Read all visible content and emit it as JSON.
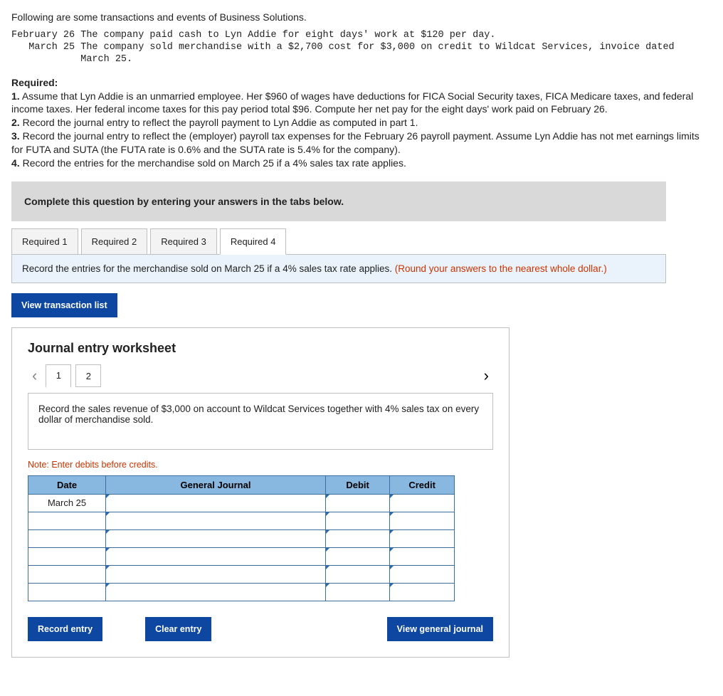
{
  "intro": "Following are some transactions and events of Business Solutions.",
  "mono_block": "February 26 The company paid cash to Lyn Addie for eight days' work at $120 per day.\n   March 25 The company sold merchandise with a $2,700 cost for $3,000 on credit to Wildcat Services, invoice dated\n            March 25.",
  "required": {
    "heading": "Required:",
    "r1": "1. Assume that Lyn Addie is an unmarried employee. Her $960 of wages have deductions for FICA Social Security taxes, FICA Medicare taxes, and federal income taxes. Her federal income taxes for this pay period total $96. Compute her net pay for the eight days' work paid on February 26.",
    "r2": "2. Record the journal entry to reflect the payroll payment to Lyn Addie as computed in part 1.",
    "r3": "3. Record the journal entry to reflect the (employer) payroll tax expenses for the February 26 payroll payment. Assume Lyn Addie has not met earnings limits for FUTA and SUTA (the FUTA rate is 0.6% and the SUTA rate is 5.4% for the company).",
    "r4": "4. Record the entries for the merchandise sold on March 25 if a 4% sales tax rate applies."
  },
  "instruction_bar": "Complete this question by entering your answers in the tabs below.",
  "tabs": [
    "Required 1",
    "Required 2",
    "Required 3",
    "Required 4"
  ],
  "active_tab": 3,
  "tab_prompt": {
    "text": "Record the entries for the merchandise sold on March 25 if a 4% sales tax rate applies. ",
    "hint": "(Round your answers to the nearest whole dollar.)"
  },
  "view_trans_btn": "View transaction list",
  "worksheet": {
    "title": "Journal entry worksheet",
    "pages": [
      "1",
      "2"
    ],
    "active_page": 0,
    "desc": "Record the sales revenue of $3,000 on account to Wildcat Services together with 4% sales tax on every dollar of merchandise sold.",
    "note": "Note: Enter debits before credits.",
    "headers": {
      "date": "Date",
      "gj": "General Journal",
      "debit": "Debit",
      "credit": "Credit"
    },
    "rows": [
      {
        "date": "March 25",
        "gj": "",
        "debit": "",
        "credit": ""
      },
      {
        "date": "",
        "gj": "",
        "debit": "",
        "credit": ""
      },
      {
        "date": "",
        "gj": "",
        "debit": "",
        "credit": ""
      },
      {
        "date": "",
        "gj": "",
        "debit": "",
        "credit": ""
      },
      {
        "date": "",
        "gj": "",
        "debit": "",
        "credit": ""
      },
      {
        "date": "",
        "gj": "",
        "debit": "",
        "credit": ""
      }
    ],
    "buttons": {
      "record": "Record entry",
      "clear": "Clear entry",
      "view": "View general journal"
    }
  }
}
